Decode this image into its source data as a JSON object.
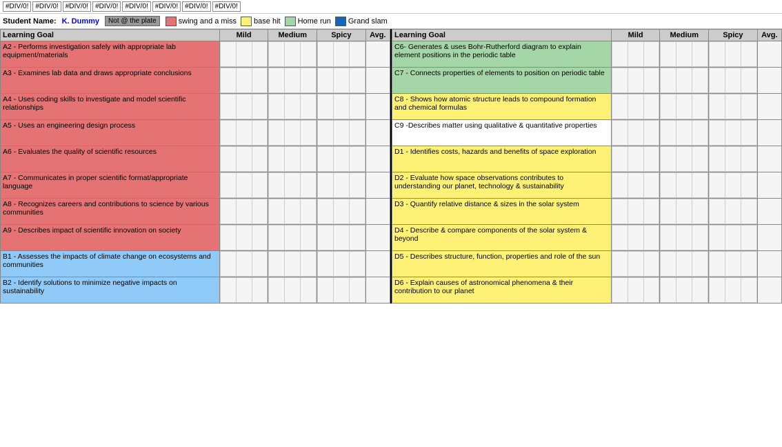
{
  "topErrors": [
    "#DIV/0!",
    "#DIV/0!",
    "#DIV/0!",
    "#DIV/0!",
    "#DIV/0!",
    "#DIV/0!",
    "#DIV/0!",
    "#DIV/0!"
  ],
  "student": {
    "label": "Student Name:",
    "name": "K. Dummy",
    "notAtPlate": "Not @ the plate"
  },
  "legend": [
    {
      "color": "#e57373",
      "label": "swing and a miss"
    },
    {
      "color": "#fff176",
      "label": "base hit"
    },
    {
      "color": "#a5d6a7",
      "label": "Home run"
    },
    {
      "color": "#1565c0",
      "label": "Grand slam"
    }
  ],
  "headers": {
    "learningGoal": "Learning Goal",
    "mild": "Mild",
    "medium": "Medium",
    "spicy": "Spicy",
    "avg": "Avg."
  },
  "leftGoals": [
    {
      "id": "A2",
      "text": "A2 - Performs investigation safely with appropriate lab equipment/materials",
      "color": "red"
    },
    {
      "id": "A3",
      "text": "A3 - Examines lab data and draws appropriate conclusions",
      "color": "red"
    },
    {
      "id": "A4",
      "text": "A4 - Uses coding skills to investigate and model scientific relationships",
      "color": "red"
    },
    {
      "id": "A5",
      "text": "A5 - Uses an engineering design process",
      "color": "red"
    },
    {
      "id": "A6",
      "text": "A6 - Evaluates the quality of scientific resources",
      "color": "red"
    },
    {
      "id": "A7",
      "text": "A7 - Communicates in proper scientific format/appropriate language",
      "color": "red"
    },
    {
      "id": "A8",
      "text": "A8 - Recognizes careers and contributions to science by various communities",
      "color": "red"
    },
    {
      "id": "A9",
      "text": "A9 - Describes impact of scientific innovation on society",
      "color": "red"
    },
    {
      "id": "B1",
      "text": "B1 - Assesses the impacts of climate change on ecosystems and communities",
      "color": "blue"
    },
    {
      "id": "B2",
      "text": "B2 - Identify solutions to minimize negative impacts on sustainability",
      "color": "blue"
    }
  ],
  "rightGoals": [
    {
      "id": "C6",
      "text": "C6- Generates & uses Bohr-Rutherford diagram to explain element positions in the periodic table",
      "color": "green"
    },
    {
      "id": "C7",
      "text": "C7 - Connects properties of elements to position on periodic table",
      "color": "green",
      "highlight": true
    },
    {
      "id": "C8",
      "text": "C8 - Shows how atomic structure leads to compound formation and chemical formulas",
      "color": "yellow"
    },
    {
      "id": "C9",
      "text": "C9 -Describes matter using qualitative & quantitative properties",
      "color": "white"
    },
    {
      "id": "D1",
      "text": "D1 - Identifies costs, hazards and benefits of space exploration",
      "color": "yellow"
    },
    {
      "id": "D2",
      "text": "D2 - Evaluate how space observations contributes to understanding our planet, technology & sustainability",
      "color": "yellow"
    },
    {
      "id": "D3",
      "text": "D3 - Quantify relative distance & sizes in the solar system",
      "color": "yellow"
    },
    {
      "id": "D4",
      "text": "D4 - Describe & compare components of the solar system & beyond",
      "color": "yellow"
    },
    {
      "id": "D5",
      "text": "D5 - Describes structure, function, properties and role of the sun",
      "color": "yellow"
    },
    {
      "id": "D6",
      "text": "D6 - Explain causes of astronomical phenomena & their contribution to our planet",
      "color": "yellow"
    }
  ]
}
